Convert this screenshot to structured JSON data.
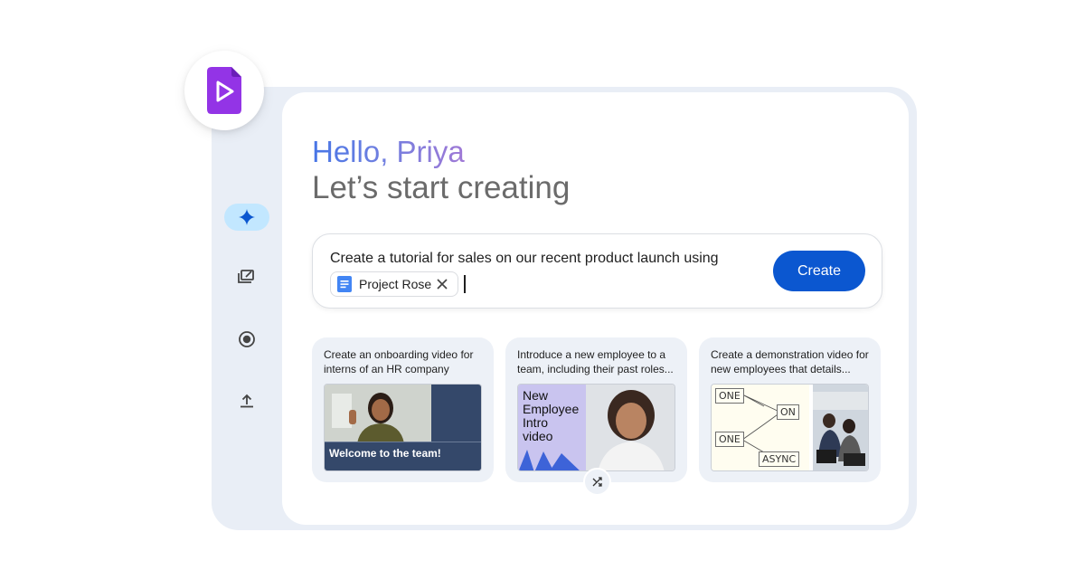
{
  "greeting": {
    "hello": "Hello, Priya",
    "subtitle": "Let’s start creating"
  },
  "prompt": {
    "text": "Create a tutorial for sales on our recent product launch using",
    "chip_label": "Project Rose",
    "create_label": "Create"
  },
  "rail": {
    "items": [
      {
        "icon": "sparkle-icon",
        "active": true
      },
      {
        "icon": "gallery-edit-icon",
        "active": false
      },
      {
        "icon": "record-icon",
        "active": false
      },
      {
        "icon": "upload-icon",
        "active": false
      }
    ]
  },
  "cards": [
    {
      "text": "Create an onboarding video for interns of an HR company",
      "thumb_caption": "Welcome to the team!"
    },
    {
      "text": "Introduce a new employee to a team, including their past roles...",
      "thumb_title": "New\nEmployee\nIntro\nvideo"
    },
    {
      "text": "Create a demonstration video for new employees that details...",
      "diagram_labels": [
        "ONE",
        "ON",
        "ONE",
        "ASYNC"
      ]
    }
  ],
  "colors": {
    "accent": "#0b57d0",
    "active_rail": "#c2e7ff",
    "logo_purple": "#9334e6",
    "card_bg": "#edf1f7",
    "frame_bg": "#e9eef6"
  }
}
